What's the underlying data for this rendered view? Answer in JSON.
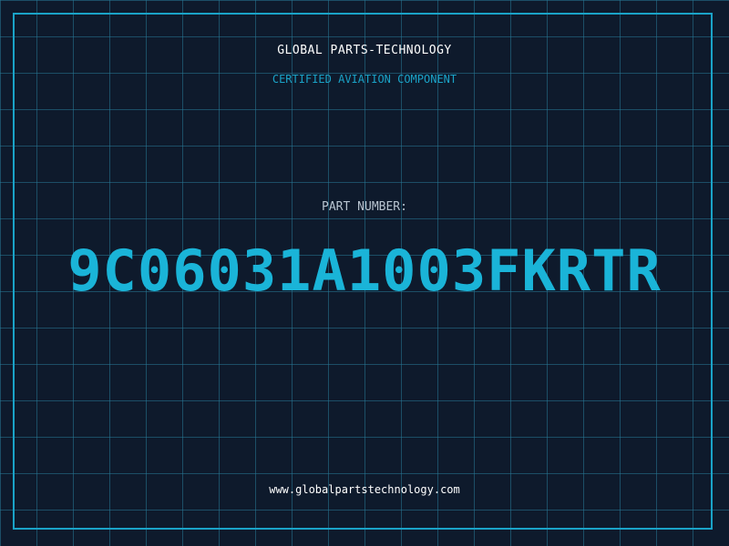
{
  "header": {
    "company": "GLOBAL PARTS-TECHNOLOGY",
    "tagline": "CERTIFIED AVIATION COMPONENT"
  },
  "part": {
    "label": "PART NUMBER:",
    "number": "9C06031A1003FKRTR"
  },
  "footer": {
    "website": "www.globalpartstechnology.com"
  },
  "colors": {
    "background": "#0e1a2c",
    "accent": "#1ab4d8",
    "grid": "#1f5f78",
    "text": "#ffffff"
  }
}
